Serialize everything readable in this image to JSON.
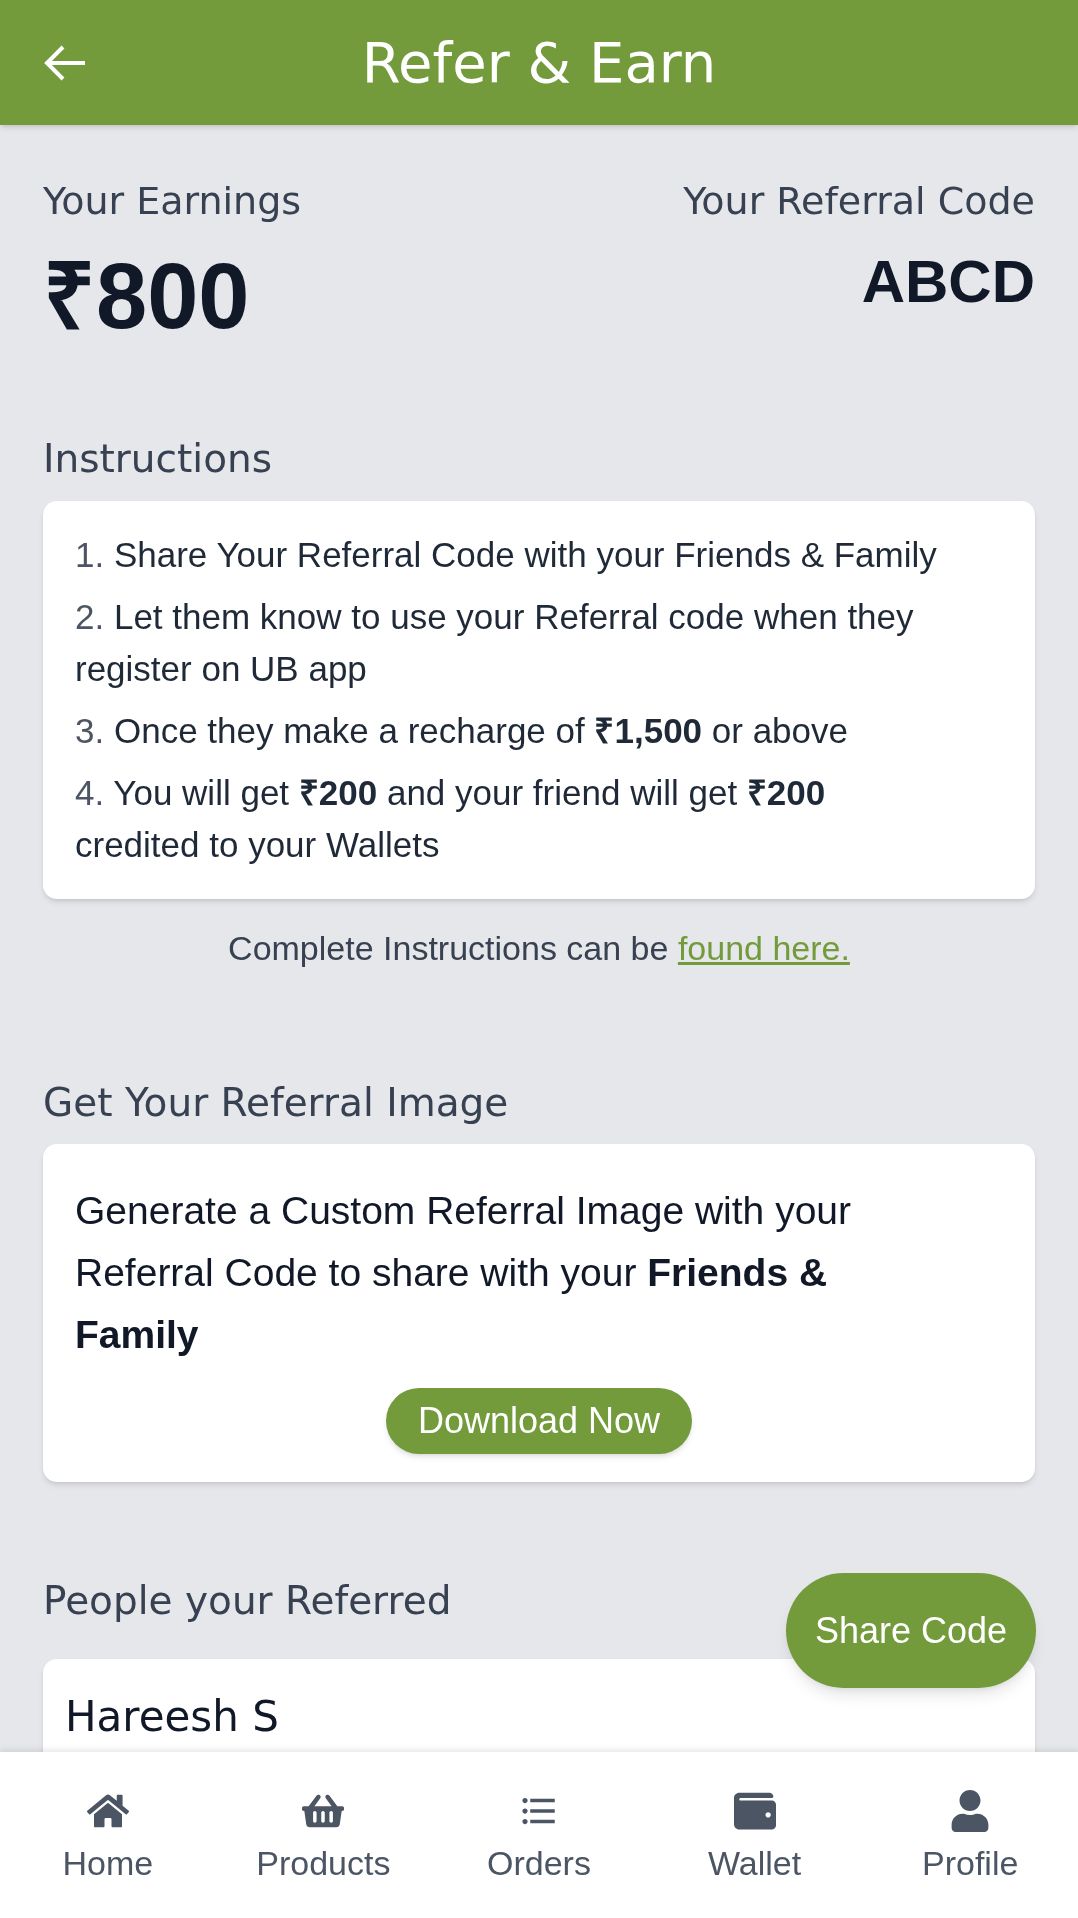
{
  "header": {
    "title": "Refer & Earn"
  },
  "earnings": {
    "label": "Your Earnings",
    "amount": "₹800"
  },
  "referral_code": {
    "label": "Your Referral Code",
    "code": "ABCD"
  },
  "instructions": {
    "heading": "Instructions",
    "steps": [
      {
        "number": "1.",
        "text": "Share Your Referral Code with your Friends & Family"
      },
      {
        "number": "2.",
        "text": "Let them know to use your Referral code when they register on UB app"
      },
      {
        "number": "3.",
        "text": "Once they make a recharge of **₹1,500** or above"
      },
      {
        "number": "4.",
        "text": "You will get **₹200** and your friend will get **₹200** credited to your Wallets"
      }
    ],
    "note": "Complete Instructions can be",
    "link": "found here."
  },
  "referral_image": {
    "heading": "Get Your Referral Image",
    "text": "Generate a Custom Referral Image with your Referral Code to share with your **Friends & Family**",
    "button": "Download Now"
  },
  "referred": {
    "heading": "People your Referred",
    "people": [
      {
        "name": "Hareesh S"
      }
    ]
  },
  "share_button": "Share Code",
  "bottom_nav": [
    {
      "label": "Home"
    },
    {
      "label": "Products"
    },
    {
      "label": "Orders"
    },
    {
      "label": "Wallet"
    },
    {
      "label": "Profile"
    }
  ]
}
